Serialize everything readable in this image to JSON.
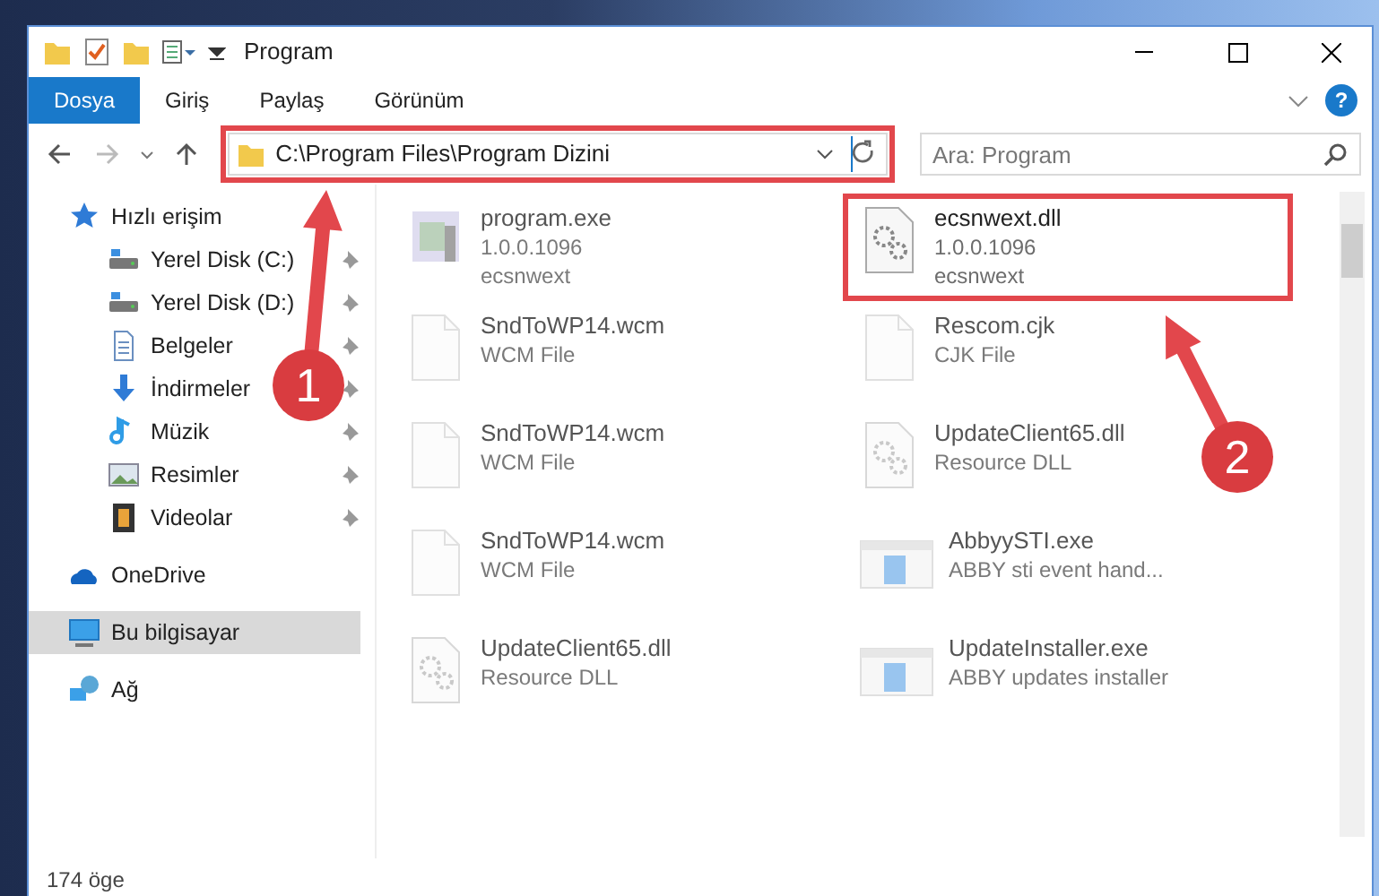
{
  "window": {
    "title": "Program"
  },
  "ribbon_tabs": [
    {
      "label": "Dosya",
      "selected": true
    },
    {
      "label": "Giriş",
      "selected": false
    },
    {
      "label": "Paylaş",
      "selected": false
    },
    {
      "label": "Görünüm",
      "selected": false
    }
  ],
  "help_button": "?",
  "address_bar": {
    "path": "C:\\Program Files\\Program Dizini",
    "highlighted": true
  },
  "search": {
    "placeholder": "Ara: Program"
  },
  "sidebar": {
    "items": [
      {
        "label": "Hızlı erişim",
        "kind": "star",
        "selected": false,
        "children": [
          {
            "label": "Yerel Disk (C:)",
            "kind": "drive",
            "pinned": true,
            "selected": false
          },
          {
            "label": "Yerel Disk (D:)",
            "kind": "drive",
            "pinned": true,
            "selected": false
          },
          {
            "label": "Belgeler",
            "kind": "doc",
            "pinned": true,
            "selected": false
          },
          {
            "label": "İndirmeler",
            "kind": "download",
            "pinned": true,
            "selected": false
          },
          {
            "label": "Müzik",
            "kind": "music",
            "pinned": true,
            "selected": false
          },
          {
            "label": "Resimler",
            "kind": "picture",
            "pinned": true,
            "selected": false
          },
          {
            "label": "Videolar",
            "kind": "film",
            "pinned": true,
            "selected": false
          }
        ]
      },
      {
        "label": "OneDrive",
        "kind": "cloud",
        "selected": false
      },
      {
        "label": "Bu bilgisayar",
        "kind": "pc",
        "selected": true
      },
      {
        "label": "Ağ",
        "kind": "network",
        "selected": false
      }
    ]
  },
  "files": [
    {
      "name": "program.exe",
      "lines": [
        "1.0.0.1096",
        "ecsnwext"
      ],
      "kind": "app",
      "blurred": true,
      "highlighted": false
    },
    {
      "name": "ecsnwext.dll",
      "lines": [
        "1.0.0.1096",
        "ecsnwext"
      ],
      "kind": "gear",
      "blurred": false,
      "highlighted": true
    },
    {
      "name": "SndToWP14.wcm",
      "lines": [
        "WCM File"
      ],
      "kind": "blank",
      "blurred": true,
      "highlighted": false
    },
    {
      "name": "Rescom.cjk",
      "lines": [
        "CJK File"
      ],
      "kind": "blank",
      "blurred": true,
      "highlighted": false
    },
    {
      "name": "SndToWP14.wcm",
      "lines": [
        "WCM File"
      ],
      "kind": "blank",
      "blurred": true,
      "highlighted": false
    },
    {
      "name": "UpdateClient65.dll",
      "lines": [
        "Resource DLL"
      ],
      "kind": "gear",
      "blurred": true,
      "highlighted": false
    },
    {
      "name": "SndToWP14.wcm",
      "lines": [
        "WCM File"
      ],
      "kind": "blank",
      "blurred": true,
      "highlighted": false
    },
    {
      "name": "AbbyySTI.exe",
      "lines": [
        "ABBY sti event hand..."
      ],
      "kind": "window",
      "blurred": true,
      "highlighted": false
    },
    {
      "name": "UpdateClient65.dll",
      "lines": [
        "Resource DLL"
      ],
      "kind": "gear",
      "blurred": true,
      "highlighted": false
    },
    {
      "name": "UpdateInstaller.exe",
      "lines": [
        "ABBY updates installer"
      ],
      "kind": "window",
      "blurred": true,
      "highlighted": false
    }
  ],
  "status_bar": {
    "count": "174 öge"
  },
  "annotations": [
    {
      "number": "1"
    },
    {
      "number": "2"
    }
  ]
}
